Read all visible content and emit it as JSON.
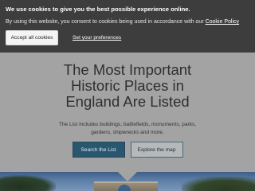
{
  "cookie_banner": {
    "title": "We use cookies to give you the best possible experience online.",
    "text_before_link": "By using this website, you consent to cookies being used in accordance with our ",
    "policy_link": "Cookie Policy",
    "accept_label": "Accept all cookies",
    "preferences_label": "Set your preferences"
  },
  "hero": {
    "title_line1": "The Most Important",
    "title_line2": "Historic Places in",
    "title_line3": "England Are Listed",
    "description_line1": "The List includes buildings, battlefields, monuments, parks,",
    "description_line2": "gardens, shipwrecks and more.",
    "search_button": "Search the List",
    "map_button": "Explore the map"
  },
  "colors": {
    "banner_bg": "#3d3d3d",
    "primary_button": "#2a5770",
    "hero_bg": "#a3a3a3"
  }
}
